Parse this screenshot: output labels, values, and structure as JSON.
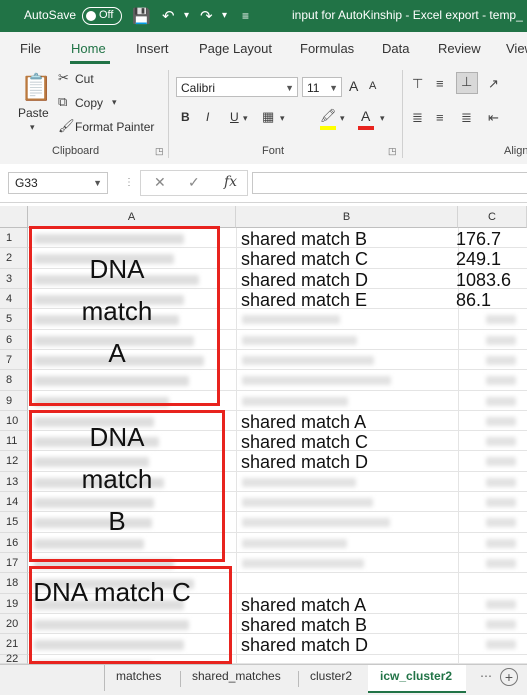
{
  "titlebar": {
    "autosave_label": "AutoSave",
    "autosave_state": "Off",
    "title": "input for AutoKinship - Excel export - temp_"
  },
  "ribbon_tabs": [
    "File",
    "Home",
    "Insert",
    "Page Layout",
    "Formulas",
    "Data",
    "Review",
    "View"
  ],
  "active_tab": "Home",
  "clipboard": {
    "paste": "Paste",
    "cut": "Cut",
    "copy": "Copy",
    "format_painter": "Format Painter",
    "group_label": "Clipboard"
  },
  "font": {
    "family": "Calibri",
    "size": "11",
    "group_label": "Font",
    "bold": "B",
    "italic": "I",
    "underline": "U",
    "grow": "A",
    "shrink": "A"
  },
  "alignment": {
    "group_label": "Alignment"
  },
  "formula_bar": {
    "name_box": "G33",
    "fx": "fx",
    "cancel": "✕",
    "enter": "✓",
    "value": ""
  },
  "columns": [
    "A",
    "B",
    "C"
  ],
  "rows": [
    "1",
    "2",
    "3",
    "4",
    "5",
    "6",
    "7",
    "8",
    "9",
    "10",
    "11",
    "12",
    "13",
    "14",
    "15",
    "16",
    "17",
    "18",
    "19",
    "20",
    "21",
    "22"
  ],
  "col_b": [
    {
      "row": 1,
      "text": "shared match B"
    },
    {
      "row": 2,
      "text": "shared match C"
    },
    {
      "row": 3,
      "text": "shared match D"
    },
    {
      "row": 4,
      "text": "shared match E"
    },
    {
      "row": 10,
      "text": "shared match A"
    },
    {
      "row": 11,
      "text": "shared match C"
    },
    {
      "row": 12,
      "text": "shared match D"
    },
    {
      "row": 19,
      "text": "shared match A"
    },
    {
      "row": 20,
      "text": "shared match B"
    },
    {
      "row": 21,
      "text": "shared match D"
    }
  ],
  "col_c": [
    {
      "row": 1,
      "text": "176.7"
    },
    {
      "row": 2,
      "text": "249.1"
    },
    {
      "row": 3,
      "text": "1083.6"
    },
    {
      "row": 4,
      "text": "86.1"
    }
  ],
  "annotations": [
    {
      "label": "DNA match A"
    },
    {
      "label": "DNA match B"
    },
    {
      "label": "DNA match C"
    }
  ],
  "annotation_color": "#e8231e",
  "sheet_tabs": [
    "matches",
    "shared_matches",
    "cluster2",
    "icw_cluster2"
  ],
  "active_sheet": "icw_cluster2",
  "accent_color": "#217346"
}
